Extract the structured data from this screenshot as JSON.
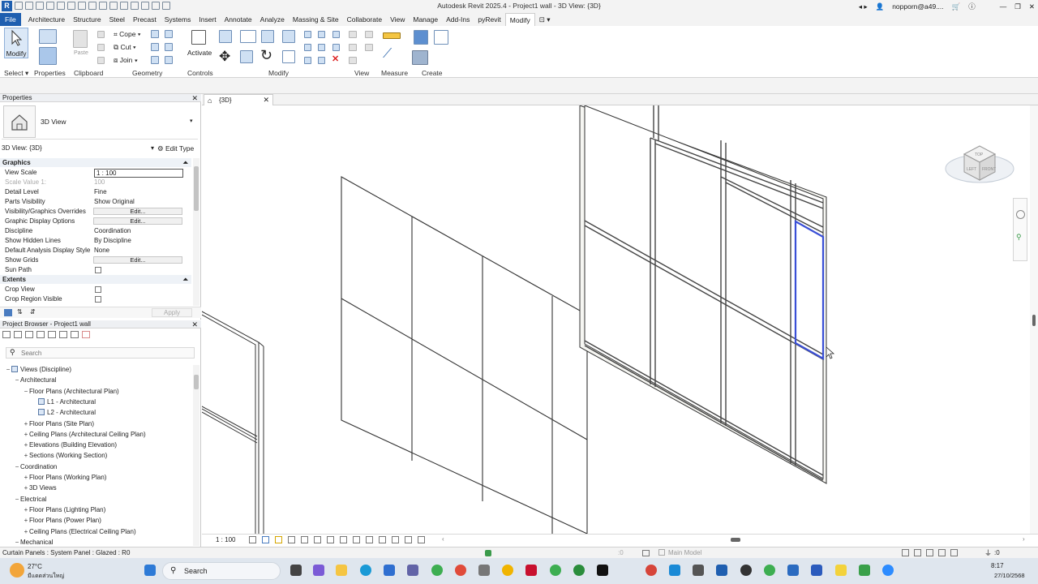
{
  "window": {
    "title": "Autodesk Revit 2025.4 - Project1 wall - 3D View: {3D}",
    "user": "nopporn@a49....",
    "logo": "R"
  },
  "tabs": [
    "File",
    "Architecture",
    "Structure",
    "Steel",
    "Precast",
    "Systems",
    "Insert",
    "Annotate",
    "Analyze",
    "Massing & Site",
    "Collaborate",
    "View",
    "Manage",
    "Add-Ins",
    "pyRevit",
    "Modify"
  ],
  "active_tab": "Modify",
  "ribbon": {
    "modify_label": "Modify",
    "panels": [
      "Select",
      "Properties",
      "Clipboard",
      "Geometry",
      "Controls",
      "Modify",
      "View",
      "Measure",
      "Create"
    ],
    "paste_label": "Paste",
    "cope_label": "Cope",
    "cut_label": "Cut",
    "join_label": "Join",
    "activate_label": "Activate"
  },
  "properties": {
    "header": "Properties",
    "type_name": "3D View",
    "instance_selector": "3D View: {3D}",
    "edit_type": "Edit Type",
    "sections": {
      "graphics": "Graphics",
      "extents": "Extents"
    },
    "rows": [
      {
        "key": "View Scale",
        "value": "1 : 100",
        "kind": "input"
      },
      {
        "key": "Scale Value    1:",
        "value": "100",
        "kind": "disabled"
      },
      {
        "key": "Detail Level",
        "value": "Fine",
        "kind": "text"
      },
      {
        "key": "Parts Visibility",
        "value": "Show Original",
        "kind": "text"
      },
      {
        "key": "Visibility/Graphics Overrides",
        "value": "Edit...",
        "kind": "button"
      },
      {
        "key": "Graphic Display Options",
        "value": "Edit...",
        "kind": "button"
      },
      {
        "key": "Discipline",
        "value": "Coordination",
        "kind": "text"
      },
      {
        "key": "Show Hidden Lines",
        "value": "By Discipline",
        "kind": "text"
      },
      {
        "key": "Default Analysis Display Style",
        "value": "None",
        "kind": "text"
      },
      {
        "key": "Show Grids",
        "value": "Edit...",
        "kind": "button"
      },
      {
        "key": "Sun Path",
        "value": "",
        "kind": "check"
      }
    ],
    "extent_rows": [
      {
        "key": "Crop View",
        "value": "",
        "kind": "check"
      },
      {
        "key": "Crop Region Visible",
        "value": "",
        "kind": "check"
      }
    ],
    "apply": "Apply"
  },
  "browser": {
    "header": "Project Browser - Project1 wall",
    "search_placeholder": "Search",
    "nodes": [
      {
        "indent": 0,
        "pm": "−",
        "label": "Views (Discipline)",
        "icon": true
      },
      {
        "indent": 1,
        "pm": "−",
        "label": "Architectural"
      },
      {
        "indent": 2,
        "pm": "−",
        "label": "Floor Plans (Architectural Plan)"
      },
      {
        "indent": 3,
        "pm": "",
        "label": "L1 - Architectural",
        "icon": true
      },
      {
        "indent": 3,
        "pm": "",
        "label": "L2 - Architectural",
        "icon": true
      },
      {
        "indent": 2,
        "pm": "+",
        "label": "Floor Plans (Site Plan)"
      },
      {
        "indent": 2,
        "pm": "+",
        "label": "Ceiling Plans (Architectural Ceiling Plan)"
      },
      {
        "indent": 2,
        "pm": "+",
        "label": "Elevations (Building Elevation)"
      },
      {
        "indent": 2,
        "pm": "+",
        "label": "Sections (Working Section)"
      },
      {
        "indent": 1,
        "pm": "−",
        "label": "Coordination"
      },
      {
        "indent": 2,
        "pm": "+",
        "label": "Floor Plans (Working Plan)"
      },
      {
        "indent": 2,
        "pm": "+",
        "label": "3D Views"
      },
      {
        "indent": 1,
        "pm": "−",
        "label": "Electrical"
      },
      {
        "indent": 2,
        "pm": "+",
        "label": "Floor Plans (Lighting Plan)"
      },
      {
        "indent": 2,
        "pm": "+",
        "label": "Floor Plans (Power Plan)"
      },
      {
        "indent": 2,
        "pm": "+",
        "label": "Ceiling Plans (Electrical Ceiling Plan)"
      },
      {
        "indent": 1,
        "pm": "−",
        "label": "Mechanical"
      }
    ]
  },
  "view": {
    "tab_label": "{3D}",
    "scale": "1 : 100",
    "cube_top": "TOP",
    "cube_left": "LEFT",
    "cube_front": "FRONT"
  },
  "status": {
    "text": "Curtain Panels : System Panel : Glazed : R0",
    "zero": ":0",
    "model": "Main Model",
    "filter": ":0"
  },
  "taskbar": {
    "weather_temp": "27°C",
    "weather_desc": "มีแดดส่วนใหญ่",
    "search": "Search",
    "time": "8:17",
    "date": "27/10/2568"
  },
  "colors": {
    "accent": "#1f5fb0",
    "selection": "#3a4fd6",
    "frame": "#8a8a80"
  }
}
